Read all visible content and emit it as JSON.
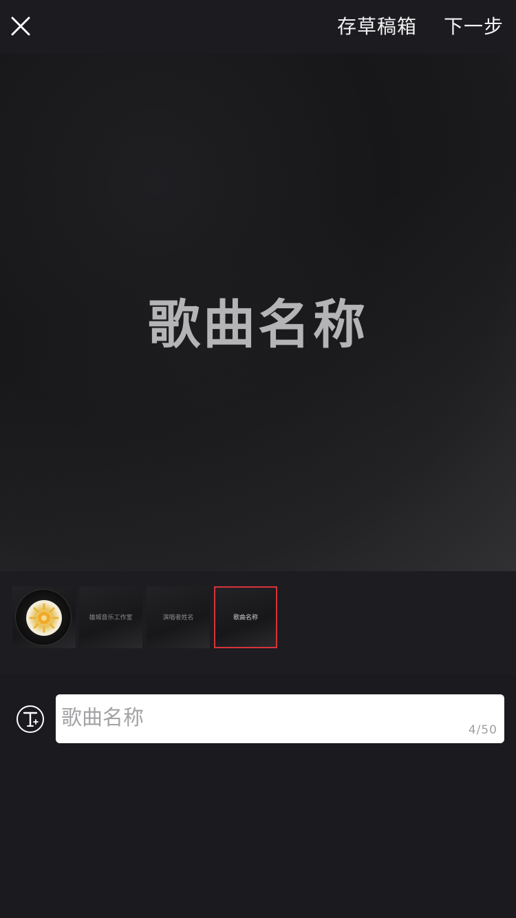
{
  "topbar": {
    "close_icon": "close-icon",
    "drafts_label": "存草稿箱",
    "next_label": "下一步"
  },
  "preview": {
    "title": "歌曲名称"
  },
  "thumbnails": [
    {
      "label": "",
      "icon": "music-disc-icon"
    },
    {
      "label": "雄城音乐工作室"
    },
    {
      "label": "演唱者姓名"
    },
    {
      "label": "歌曲名称",
      "selected": true
    }
  ],
  "editor": {
    "text_tool_icon": "text-add-icon",
    "input_value": "",
    "input_placeholder": "歌曲名称",
    "counter": "4/50"
  },
  "colors": {
    "background": "#1b1a1f",
    "selected_border": "#d8333a",
    "title_text": "#b4b4b6"
  }
}
